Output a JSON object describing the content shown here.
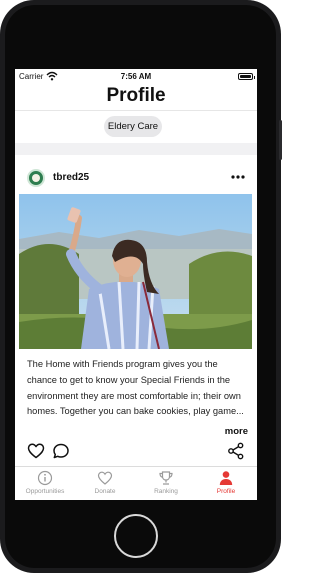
{
  "status_bar": {
    "carrier": "Carrier",
    "time": "7:56 AM"
  },
  "header": {
    "title": "Profile"
  },
  "filter_chip": {
    "label": "Eldery Care"
  },
  "post": {
    "username": "tbred25",
    "image_icon": "woman-taking-selfie-photo",
    "caption": "The Home with Friends program gives you the chance to get to know your Special Friends in the environment they are most comfortable in; their own homes. Together you can bake cookies, play game...",
    "more_label": "more",
    "actions": {
      "like_icon": "heart-outline-icon",
      "comment_icon": "comment-bubble-icon",
      "share_icon": "share-nodes-icon"
    }
  },
  "tab_bar": {
    "tabs": [
      {
        "label": "Opportunities",
        "icon": "info-circle-icon",
        "active": false
      },
      {
        "label": "Donate",
        "icon": "heart-icon",
        "active": false
      },
      {
        "label": "Ranking",
        "icon": "trophy-icon",
        "active": false
      },
      {
        "label": "Profile",
        "icon": "person-icon",
        "active": true
      }
    ]
  },
  "colors": {
    "accent": "#e53935",
    "inactive_tab": "#9a9a9a",
    "chip_bg": "#e7e7e9",
    "frame": "#1b1b1d"
  }
}
